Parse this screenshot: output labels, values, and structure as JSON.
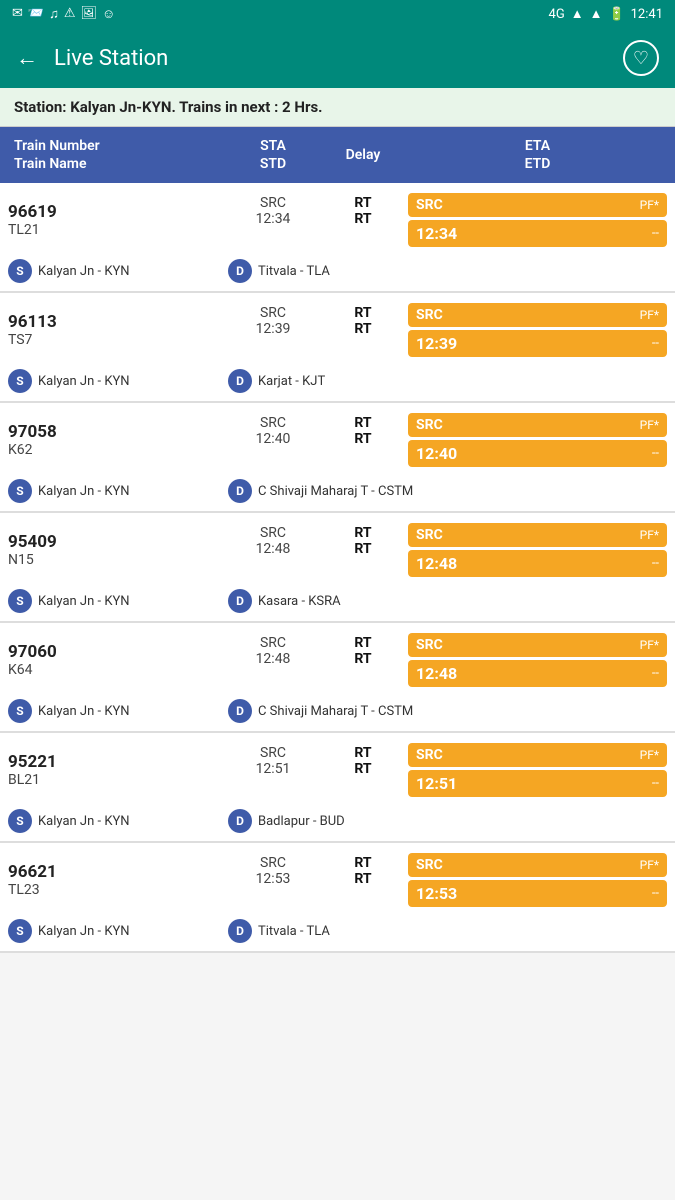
{
  "statusBar": {
    "icons": [
      "mail",
      "envelope",
      "music",
      "alert",
      "image",
      "smiley"
    ],
    "network": "4G",
    "signal1": "strong",
    "signal2": "medium",
    "battery": "full",
    "time": "12:41"
  },
  "header": {
    "back_label": "←",
    "title": "Live Station",
    "heart_icon": "♡"
  },
  "stationInfo": {
    "text": "Station: Kalyan Jn-KYN. Trains in next : 2 Hrs."
  },
  "tableHeader": {
    "col1_line1": "Train Number",
    "col1_line2": "Train Name",
    "col2_line1": "STA",
    "col2_line2": "STD",
    "col3": "Delay",
    "col4_line1": "ETA",
    "col4_line2": "ETD"
  },
  "trains": [
    {
      "number": "96619",
      "code": "TL21",
      "source": "Kalyan Jn - KYN",
      "dest": "Titvala - TLA",
      "sta": "SRC",
      "std": "12:34",
      "delay_line1": "RT",
      "delay_line2": "RT",
      "eta": "SRC",
      "pf": "PF*",
      "etd": "12:34",
      "dash": "--"
    },
    {
      "number": "96113",
      "code": "TS7",
      "source": "Kalyan Jn - KYN",
      "dest": "Karjat - KJT",
      "sta": "SRC",
      "std": "12:39",
      "delay_line1": "RT",
      "delay_line2": "RT",
      "eta": "SRC",
      "pf": "PF*",
      "etd": "12:39",
      "dash": "--"
    },
    {
      "number": "97058",
      "code": "K62",
      "source": "Kalyan Jn - KYN",
      "dest": "C Shivaji Maharaj T - CSTM",
      "sta": "SRC",
      "std": "12:40",
      "delay_line1": "RT",
      "delay_line2": "RT",
      "eta": "SRC",
      "pf": "PF*",
      "etd": "12:40",
      "dash": "--"
    },
    {
      "number": "95409",
      "code": "N15",
      "source": "Kalyan Jn - KYN",
      "dest": "Kasara - KSRA",
      "sta": "SRC",
      "std": "12:48",
      "delay_line1": "RT",
      "delay_line2": "RT",
      "eta": "SRC",
      "pf": "PF*",
      "etd": "12:48",
      "dash": "--"
    },
    {
      "number": "97060",
      "code": "K64",
      "source": "Kalyan Jn - KYN",
      "dest": "C Shivaji Maharaj T - CSTM",
      "sta": "SRC",
      "std": "12:48",
      "delay_line1": "RT",
      "delay_line2": "RT",
      "eta": "SRC",
      "pf": "PF*",
      "etd": "12:48",
      "dash": "--"
    },
    {
      "number": "95221",
      "code": "BL21",
      "source": "Kalyan Jn - KYN",
      "dest": "Badlapur - BUD",
      "sta": "SRC",
      "std": "12:51",
      "delay_line1": "RT",
      "delay_line2": "RT",
      "eta": "SRC",
      "pf": "PF*",
      "etd": "12:51",
      "dash": "--"
    },
    {
      "number": "96621",
      "code": "TL23",
      "source": "Kalyan Jn - KYN",
      "dest": "Titvala - TLA",
      "sta": "SRC",
      "std": "12:53",
      "delay_line1": "RT",
      "delay_line2": "RT",
      "eta": "SRC",
      "pf": "PF*",
      "etd": "12:53",
      "dash": "--"
    }
  ]
}
